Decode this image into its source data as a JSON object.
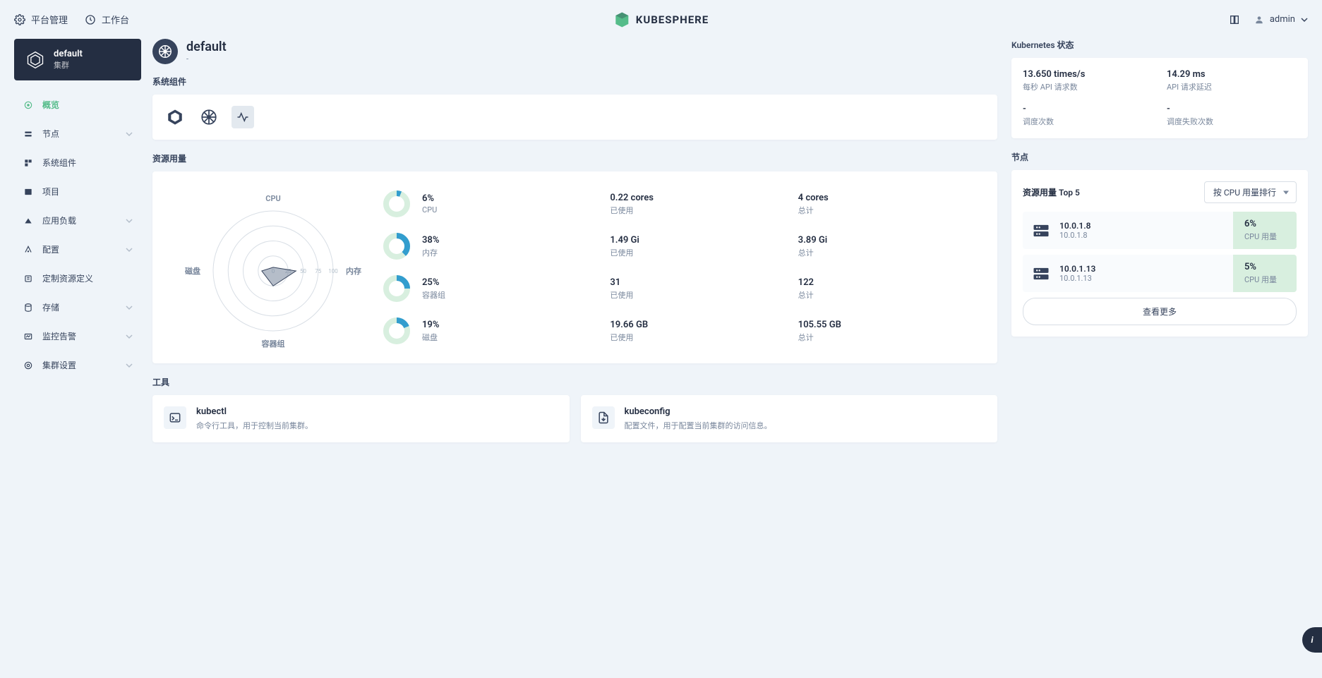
{
  "topbar": {
    "platform_mgmt": "平台管理",
    "workbench": "工作台",
    "logo_text": "KUBESPHERE",
    "user": "admin"
  },
  "sidebar": {
    "cluster_name": "default",
    "cluster_type": "集群",
    "items": [
      {
        "icon": "overview",
        "label": "概览",
        "active": true,
        "expandable": false
      },
      {
        "icon": "nodes",
        "label": "节点",
        "active": false,
        "expandable": true
      },
      {
        "icon": "components",
        "label": "系统组件",
        "active": false,
        "expandable": false
      },
      {
        "icon": "projects",
        "label": "项目",
        "active": false,
        "expandable": false
      },
      {
        "icon": "workloads",
        "label": "应用负载",
        "active": false,
        "expandable": true
      },
      {
        "icon": "config",
        "label": "配置",
        "active": false,
        "expandable": true
      },
      {
        "icon": "crd",
        "label": "定制资源定义",
        "active": false,
        "expandable": false
      },
      {
        "icon": "storage",
        "label": "存储",
        "active": false,
        "expandable": true
      },
      {
        "icon": "monitoring",
        "label": "监控告警",
        "active": false,
        "expandable": true
      },
      {
        "icon": "settings",
        "label": "集群设置",
        "active": false,
        "expandable": true
      }
    ]
  },
  "page": {
    "title": "default",
    "subtitle": "-"
  },
  "sections": {
    "components": "系统组件",
    "usage": "资源用量",
    "tools": "工具",
    "k8s_status": "Kubernetes 状态",
    "nodes": "节点"
  },
  "usage": {
    "radar_labels": {
      "cpu": "CPU",
      "memory": "内存",
      "pods": "容器组",
      "disk": "磁盘"
    },
    "rows": [
      {
        "pct": "6%",
        "pct_num": 6,
        "name": "CPU",
        "used": "0.22 cores",
        "used_label": "已使用",
        "total": "4 cores",
        "total_label": "总计"
      },
      {
        "pct": "38%",
        "pct_num": 38,
        "name": "内存",
        "used": "1.49 Gi",
        "used_label": "已使用",
        "total": "3.89 Gi",
        "total_label": "总计"
      },
      {
        "pct": "25%",
        "pct_num": 25,
        "name": "容器组",
        "used": "31",
        "used_label": "已使用",
        "total": "122",
        "total_label": "总计"
      },
      {
        "pct": "19%",
        "pct_num": 19,
        "name": "磁盘",
        "used": "19.66 GB",
        "used_label": "已使用",
        "total": "105.55 GB",
        "total_label": "总计"
      }
    ]
  },
  "tools": [
    {
      "title": "kubectl",
      "desc": "命令行工具，用于控制当前集群。"
    },
    {
      "title": "kubeconfig",
      "desc": "配置文件，用于配置当前集群的访问信息。"
    }
  ],
  "k8s": [
    {
      "value": "13.650 times/s",
      "label": "每秒 API 请求数"
    },
    {
      "value": "14.29 ms",
      "label": "API 请求延迟"
    },
    {
      "value": "-",
      "label": "调度次数"
    },
    {
      "value": "-",
      "label": "调度失败次数"
    }
  ],
  "topN": {
    "title": "资源用量 Top 5",
    "sort_label": "按 CPU 用量排行",
    "metric_label": "CPU 用量",
    "view_more": "查看更多",
    "nodes": [
      {
        "name": "10.0.1.8",
        "ip": "10.0.1.8",
        "pct": "6%"
      },
      {
        "name": "10.0.1.13",
        "ip": "10.0.1.13",
        "pct": "5%"
      }
    ]
  },
  "chart_data": {
    "type": "radar",
    "categories": [
      "CPU",
      "内存",
      "容器组",
      "磁盘"
    ],
    "values": [
      6,
      38,
      25,
      19
    ],
    "scale_ticks": [
      0,
      25,
      50,
      75,
      100
    ],
    "max": 100
  }
}
